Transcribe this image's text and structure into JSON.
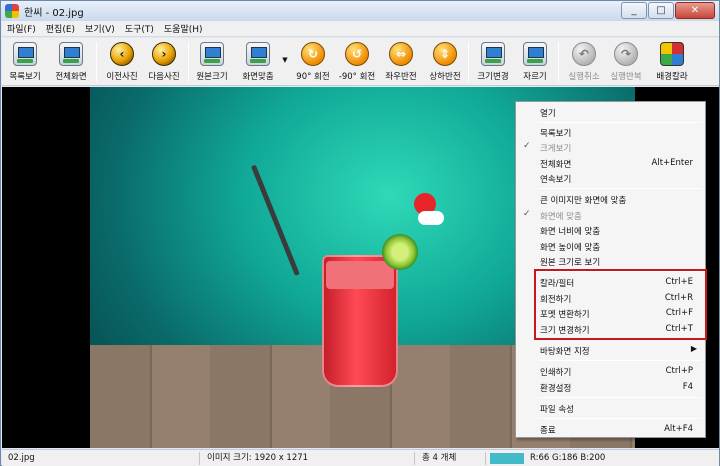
{
  "window": {
    "title": "한씨 - 02.jpg",
    "minimize_glyph": "_",
    "maximize_glyph": "□",
    "close_glyph": "✕"
  },
  "menubar": [
    "파일(F)",
    "편집(E)",
    "보기(V)",
    "도구(T)",
    "도움말(H)"
  ],
  "toolbar": {
    "list_view": "목록보기",
    "full_screen": "전체화면",
    "prev_photo": "이전사진",
    "next_photo": "다음사진",
    "original_size": "원본크기",
    "fit_screen": "화면맞춤",
    "rotate_90": "90° 회전",
    "rotate_minus_90": "-90° 회전",
    "flip_horizontal": "좌우반전",
    "flip_vertical": "상하반전",
    "resize": "크기변경",
    "crop": "자르기",
    "undo": "실행취소",
    "redo": "실행반복",
    "background_color": "배경칼라"
  },
  "context_menu": {
    "open": "열기",
    "list_view": "목록보기",
    "large_view": "크게보기",
    "full_screen": "전체화면",
    "full_screen_shortcut": "Alt+Enter",
    "continuous_view": "연속보기",
    "fit_large_only": "큰 이미지만 화면에 맞춤",
    "fit_screen": "화면에 맞춤",
    "fit_width": "화면 너비에 맞춤",
    "fit_height": "화면 높이에 맞춤",
    "view_original": "원본 크기로 보기",
    "color_filter": "칼라/필터",
    "color_filter_shortcut": "Ctrl+E",
    "rotate": "회전하기",
    "rotate_shortcut": "Ctrl+R",
    "format_convert": "포멧 변환하기",
    "format_convert_shortcut": "Ctrl+F",
    "resize": "크기 변경하기",
    "resize_shortcut": "Ctrl+T",
    "set_wallpaper": "바탕화면 지정",
    "print": "인쇄하기",
    "print_shortcut": "Ctrl+P",
    "settings": "환경설정",
    "settings_shortcut": "F4",
    "file_properties": "파일 속성",
    "exit": "종료",
    "exit_shortcut": "Alt+F4",
    "check_glyph": "✓",
    "submenu_glyph": "▶"
  },
  "statusbar": {
    "filename": "02.jpg",
    "image_size": "이미지 크기: 1920 x 1271",
    "count": "총 4 개체",
    "pixel_color_hex": "#42BAC8",
    "pixel_rgb": "R:66 G:186 B:200"
  }
}
